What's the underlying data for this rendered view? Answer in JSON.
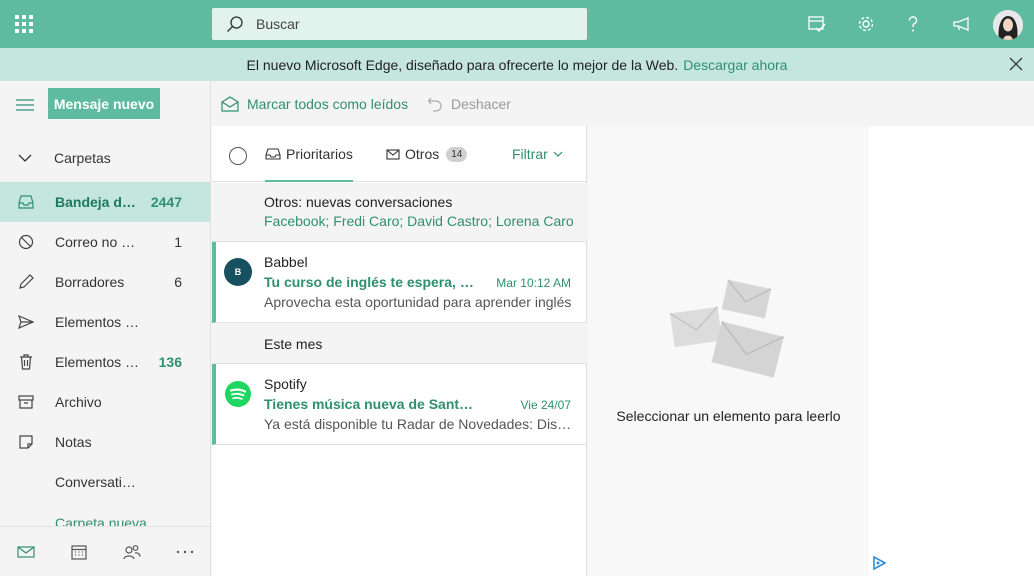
{
  "search": {
    "placeholder": "Buscar"
  },
  "banner": {
    "text": "El nuevo Microsoft Edge, diseñado para ofrecerte lo mejor de la Web.",
    "link": "Descargar ahora"
  },
  "sidebar": {
    "new_message": "Mensaje nuevo",
    "folders_label": "Carpetas",
    "folders": [
      {
        "name": "Bandeja de entrada",
        "count": "2447",
        "icon": "inbox-icon"
      },
      {
        "name": "Correo no deseado",
        "count": "1",
        "icon": "block-icon"
      },
      {
        "name": "Borradores",
        "count": "6",
        "icon": "pencil-icon"
      },
      {
        "name": "Elementos enviados",
        "count": "",
        "icon": "send-icon"
      },
      {
        "name": "Elementos eliminados",
        "count": "136",
        "icon": "trash-icon"
      },
      {
        "name": "Archivo",
        "count": "",
        "icon": "archive-icon"
      },
      {
        "name": "Notas",
        "count": "",
        "icon": "note-icon"
      },
      {
        "name": "Conversation History",
        "count": "",
        "icon": ""
      },
      {
        "name": "Carpeta nueva",
        "count": "",
        "icon": ""
      }
    ]
  },
  "toolbar": {
    "mark_all_read": "Marcar todos como leídos",
    "undo": "Deshacer"
  },
  "list": {
    "tabs": [
      {
        "label": "Prioritarios",
        "count": ""
      },
      {
        "label": "Otros",
        "count": "14"
      }
    ],
    "filter": "Filtrar",
    "others_title": "Otros: nuevas conversaciones",
    "others_senders": "Facebook; Fredi Caro; David Castro; Lorena Caro",
    "section_label": "Este mes",
    "messages": [
      {
        "sender": "Babbel",
        "avatar": "B",
        "subject": "Tu curso de inglés te espera, ahora",
        "date": "Mar 10:12 AM",
        "preview": "Aprovecha esta oportunidad para aprender inglés"
      },
      {
        "sender": "Spotify",
        "avatar": "",
        "subject": "Tienes música nueva de Santiago",
        "date": "Vie 24/07",
        "preview": "Ya está disponible tu Radar de Novedades: Disfruta"
      }
    ]
  },
  "reading": {
    "empty_text": "Seleccionar un elemento para leerlo"
  },
  "colors": {
    "accent": "#5fbb9f",
    "accent_light": "#c4e6dc",
    "link": "#2f8f70",
    "babbel": "#17515f",
    "spotify": "#1ed760"
  }
}
